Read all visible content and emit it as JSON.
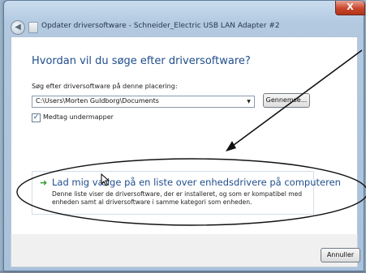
{
  "window": {
    "title": "Opdater driversoftware - Schneider_Electric USB LAN Adapter #2",
    "close_label": "X"
  },
  "heading": "Hvordan vil du søge efter driversoftware?",
  "search": {
    "label": "Søg efter driversoftware på denne placering:",
    "path_value": "C:\\Users\\Morten Guldborg\\Documents",
    "browse_label": "Gennemse..."
  },
  "include_subfolders": {
    "label": "Medtag undermapper",
    "checked": true
  },
  "option": {
    "title": "Lad mig vælge på en liste over enhedsdrivere på computeren",
    "description": "Denne liste viser de driversoftware, der er installeret, og som er kompatibel med enheden samt al driversoftware i samme kategori som enheden."
  },
  "footer": {
    "cancel_label": "Annuller"
  },
  "icons": {
    "back": "back-arrow-icon",
    "window": "device-icon",
    "option": "green-arrow-icon",
    "checkbox": "checkmark-icon",
    "dropdown": "chevron-down-icon",
    "cursor": "mouse-pointer-icon"
  },
  "colors": {
    "heading": "#1f4d8c",
    "option_arrow": "#2e9b2e",
    "close": "#c8462b"
  }
}
